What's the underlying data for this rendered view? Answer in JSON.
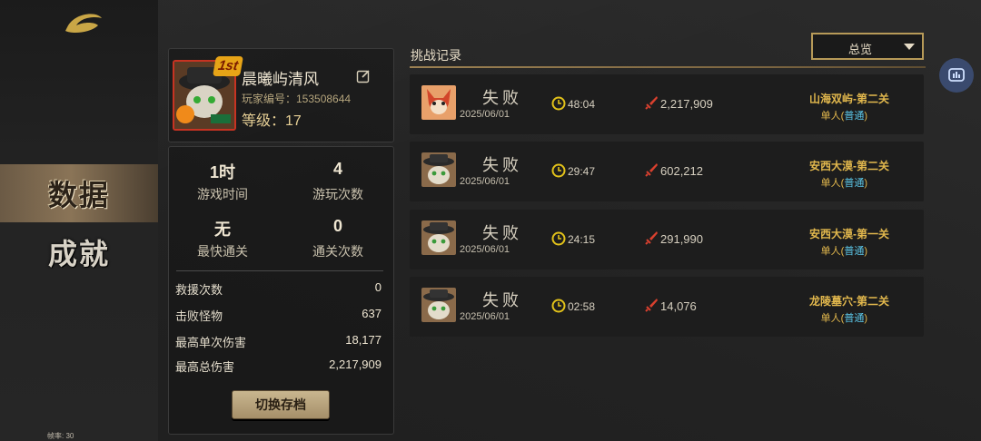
{
  "sidebar": {
    "items": [
      {
        "label": "数据",
        "active": true
      },
      {
        "label": "成就",
        "active": false
      }
    ],
    "fps_label": "帧率: 30"
  },
  "profile": {
    "rank_badge": "1st",
    "name": "晨曦屿清风",
    "id_label": "玩家编号：153508644",
    "level_label": "等级：17"
  },
  "summary": [
    {
      "value": "1时",
      "label": "游戏时间"
    },
    {
      "value": "4",
      "label": "游玩次数"
    },
    {
      "value": "无",
      "label": "最快通关"
    },
    {
      "value": "0",
      "label": "通关次数"
    }
  ],
  "details": [
    {
      "label": "救援次数",
      "value": "0"
    },
    {
      "label": "击败怪物",
      "value": "637"
    },
    {
      "label": "最高单次伤害",
      "value": "18,177"
    },
    {
      "label": "最高总伤害",
      "value": "2,217,909"
    }
  ],
  "switch_button": "切换存档",
  "records_header": {
    "title": "挑战记录",
    "filter_selected": "总览"
  },
  "records": [
    {
      "result": "失败",
      "date": "2025/06/01",
      "time": "48:04",
      "damage": "2,217,909",
      "stage": "山海双屿-第二关",
      "mode": "单人",
      "difficulty": "普通",
      "avatar": "fox-avatar-icon"
    },
    {
      "result": "失败",
      "date": "2025/06/01",
      "time": "29:47",
      "damage": "602,212",
      "stage": "安西大漠-第二关",
      "mode": "单人",
      "difficulty": "普通",
      "avatar": "cat-hat-avatar-icon"
    },
    {
      "result": "失败",
      "date": "2025/06/01",
      "time": "24:15",
      "damage": "291,990",
      "stage": "安西大漠-第一关",
      "mode": "单人",
      "difficulty": "普通",
      "avatar": "cat-hat-avatar-icon"
    },
    {
      "result": "失败",
      "date": "2025/06/01",
      "time": "02:58",
      "damage": "14,076",
      "stage": "龙陵墓穴-第二关",
      "mode": "单人",
      "difficulty": "普通",
      "avatar": "cat-hat-avatar-icon"
    }
  ],
  "colors": {
    "accent_gold": "#e2b84d",
    "difficulty_blue": "#5cc7e8",
    "badge_red": "#c73322"
  }
}
